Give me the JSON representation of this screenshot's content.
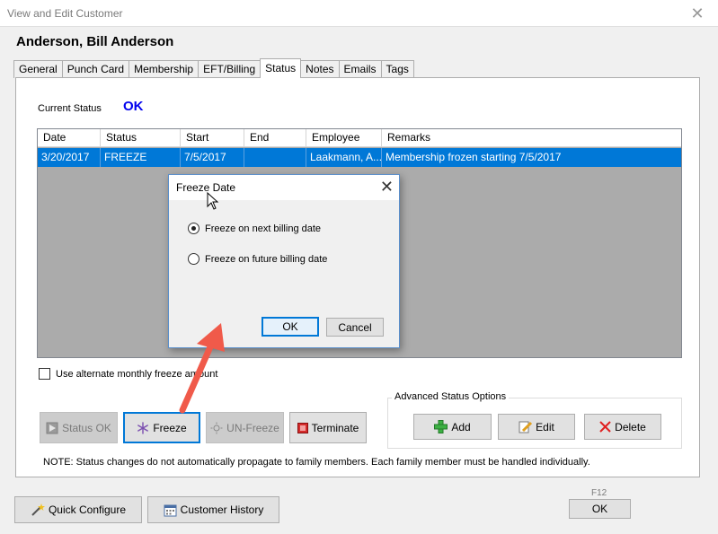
{
  "window": {
    "title": "View and Edit Customer",
    "close_glyph": "✕"
  },
  "customer": {
    "name": "Anderson, Bill Anderson"
  },
  "tabs": [
    {
      "label": "General"
    },
    {
      "label": "Punch Card"
    },
    {
      "label": "Membership"
    },
    {
      "label": "EFT/Billing"
    },
    {
      "label": "Status"
    },
    {
      "label": "Notes"
    },
    {
      "label": "Emails"
    },
    {
      "label": "Tags"
    }
  ],
  "active_tab": "Status",
  "status": {
    "label": "Current Status",
    "value": "OK",
    "value_color": "#0000ee"
  },
  "grid": {
    "columns": [
      "Date",
      "Status",
      "Start",
      "End",
      "Employee",
      "Remarks"
    ],
    "rows": [
      {
        "date": "3/20/2017",
        "status": "FREEZE",
        "start": "7/5/2017",
        "end": "",
        "employee": "Laakmann, A...",
        "remarks": "Membership frozen starting 7/5/2017"
      }
    ],
    "selected_color": "#0078d7"
  },
  "alt_freeze": {
    "label": "Use alternate monthly freeze amount",
    "checked": false
  },
  "actions": {
    "status_ok": "Status OK",
    "freeze": "Freeze",
    "unfreeze": "UN-Freeze",
    "terminate": "Terminate"
  },
  "advanced": {
    "title": "Advanced Status Options",
    "add": "Add",
    "edit": "Edit",
    "delete": "Delete"
  },
  "note": "NOTE:  Status changes do not automatically propagate to family members.  Each family member must be handled individually.",
  "footer": {
    "quick_configure": "Quick Configure",
    "customer_history": "Customer History",
    "shortcut": "F12",
    "ok": "OK"
  },
  "dialog": {
    "title": "Freeze Date",
    "close_glyph": "✕",
    "option_next": "Freeze on next billing date",
    "option_future": "Freeze on future billing date",
    "selected": "next",
    "ok": "OK",
    "cancel": "Cancel"
  },
  "annotation": {
    "arrow_color": "#f05a4a"
  }
}
